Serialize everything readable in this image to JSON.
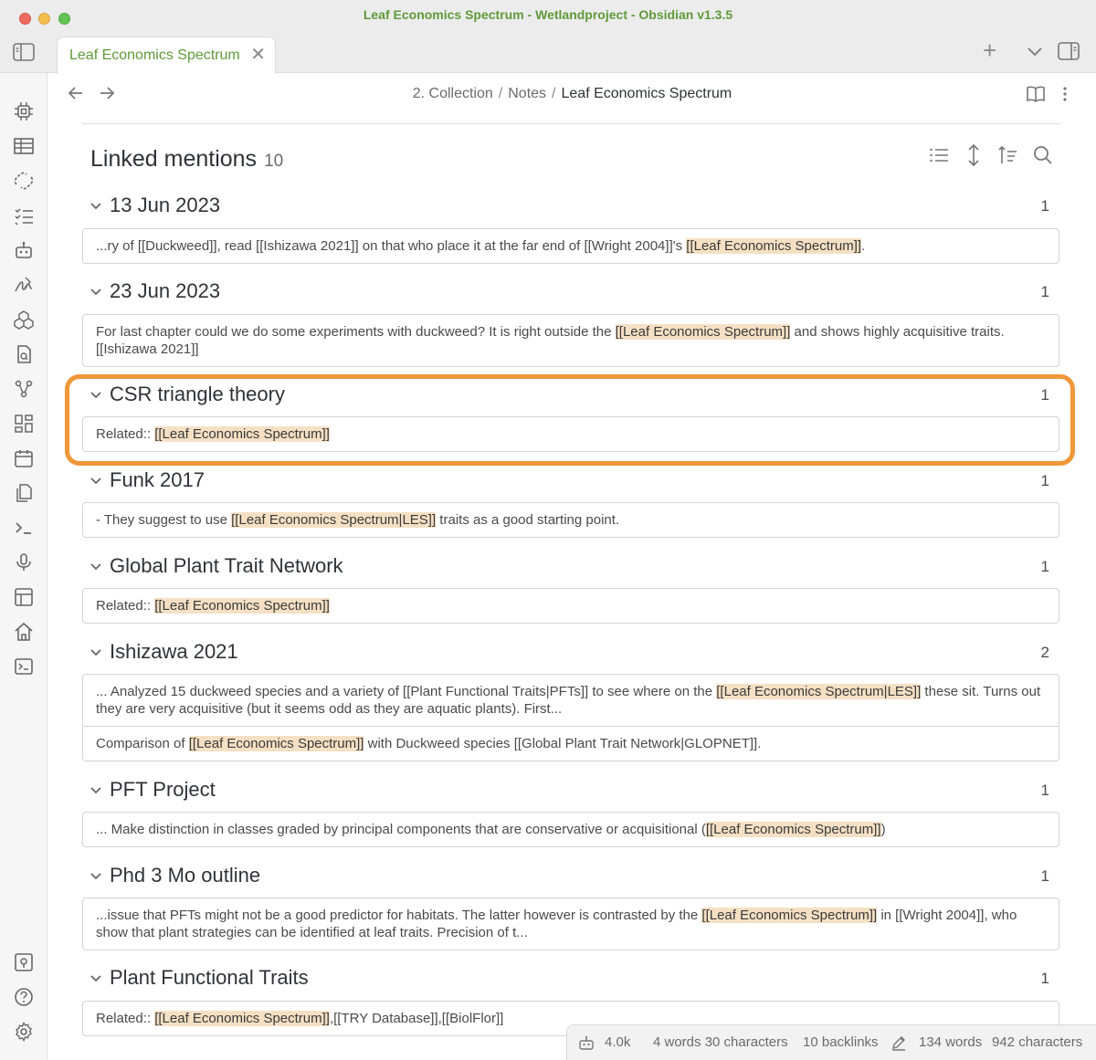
{
  "window": {
    "title": "Leaf Economics Spectrum - Wetlandproject - Obsidian v1.3.5"
  },
  "tab": {
    "label": "Leaf Economics Spectrum",
    "close": "✕"
  },
  "tabbar": {
    "new_tab": "+"
  },
  "breadcrumb": {
    "part1": "2. Collection",
    "part2": "Notes",
    "current": "Leaf Economics Spectrum",
    "sep": "/"
  },
  "linked_mentions": {
    "title": "Linked mentions",
    "count": "10",
    "groups": [
      {
        "title": "13 Jun 2023",
        "count": "1"
      },
      {
        "title": "23 Jun 2023",
        "count": "1"
      },
      {
        "title": "CSR triangle theory",
        "count": "1"
      },
      {
        "title": "Funk 2017",
        "count": "1"
      },
      {
        "title": "Global Plant Trait Network",
        "count": "1"
      },
      {
        "title": "Ishizawa 2021",
        "count": "2"
      },
      {
        "title": "PFT Project",
        "count": "1"
      },
      {
        "title": "Phd 3 Mo outline",
        "count": "1"
      },
      {
        "title": "Plant Functional Traits",
        "count": "1"
      }
    ],
    "snippets": {
      "g0": {
        "pre": "...ry of [[Duckweed]], read [[Ishizawa 2021]] on that who place it at the far end of [[Wright 2004]]'s ",
        "hl": "[[Leaf Economics Spectrum]]",
        "post": "."
      },
      "g1": {
        "pre": "For last chapter could we do some experiments with duckweed? It is right outside the ",
        "hl": "[[Leaf Economics Spectrum]]",
        "post": " and shows highly acquisitive traits. [[Ishizawa 2021]]"
      },
      "g2": {
        "pre": "Related:: ",
        "hl": "[[Leaf Economics Spectrum]]",
        "post": ""
      },
      "g3": {
        "pre": "- They suggest to use ",
        "hl": "[[Leaf Economics Spectrum|LES]]",
        "post": " traits as a good starting point."
      },
      "g4": {
        "pre": "Related:: ",
        "hl": "[[Leaf Economics Spectrum]]",
        "post": ""
      },
      "g5a": {
        "pre": "... Analyzed 15 duckweed species and a variety of [[Plant Functional Traits|PFTs]] to see where on the ",
        "hl": "[[Leaf Economics Spectrum|LES]]",
        "post": " these sit. Turns out they are very acquisitive (but it seems odd as they are aquatic plants). First..."
      },
      "g5b": {
        "pre": "Comparison of ",
        "hl": "[[Leaf Economics Spectrum]]",
        "post": " with Duckweed species [[Global Plant Trait Network|GLOPNET]]."
      },
      "g6": {
        "pre": "... Make distinction in classes graded by principal components that are conservative or acquisitional (",
        "hl": "[[Leaf Economics Spectrum]]",
        "post": ")"
      },
      "g7": {
        "pre": "...issue that PFTs might not be a good predictor for habitats. The latter however is contrasted by the ",
        "hl": "[[Leaf Economics Spectrum]]",
        "post": " in [[Wright 2004]], who show that plant strategies can be identified at leaf traits. Precision of t..."
      },
      "g8": {
        "pre": "Related:: ",
        "hl": "[[Leaf Economics Spectrum]]",
        "post": ",[[TRY Database]],[[BiolFlor]]"
      }
    }
  },
  "statusbar": {
    "size": "4.0k",
    "selection": "4 words 30 characters",
    "backlinks": "10 backlinks",
    "words": "134 words",
    "characters": "942 characters"
  },
  "colors": {
    "accent": "#5f9a3a",
    "highlight": "#f5e0c4",
    "annotation": "#f0973a"
  },
  "icons": [
    "sidebar-left-icon",
    "new-tab-icon",
    "chevron-down-icon",
    "sidebar-right-icon",
    "back-arrow-icon",
    "forward-arrow-icon",
    "reading-view-icon",
    "more-options-icon",
    "list-icon",
    "expand-vertical-icon",
    "sort-icon",
    "search-icon",
    "robot-icon",
    "pencil-icon"
  ]
}
